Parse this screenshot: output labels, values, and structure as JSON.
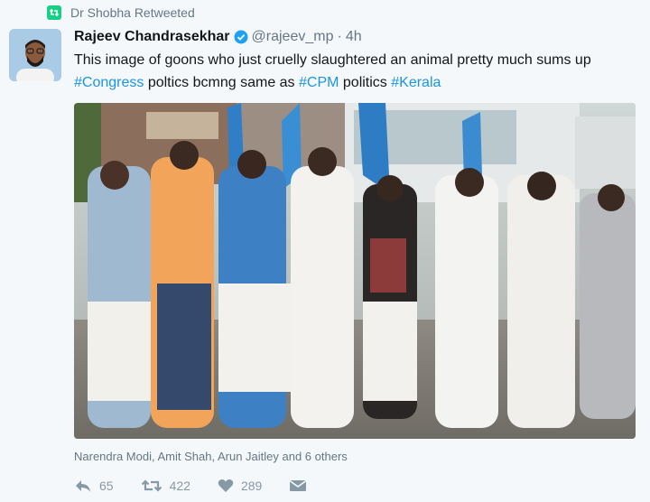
{
  "retweet": {
    "label": "Dr Shobha Retweeted"
  },
  "tweet": {
    "author": "Rajeev Chandrasekhar",
    "handle": "@rajeev_mp",
    "separator": "·",
    "time": "4h",
    "text_1": "This image of goons who just cruelly slaughtered an animal pretty much sums up ",
    "hashtag_1": "#Congress",
    "text_2": " poltics bcmng same as ",
    "hashtag_2": "#CPM",
    "text_3": " politics ",
    "hashtag_3": "#Kerala"
  },
  "likers": {
    "text": "Narendra Modi, Amit Shah, Arun Jaitley and 6 others"
  },
  "actions": {
    "replies": "65",
    "retweets": "422",
    "likes": "289"
  },
  "icons": {
    "retweet_badge": "retweet-icon",
    "verified": "verified-badge-icon",
    "reply": "reply-icon",
    "retweet": "retweet-icon",
    "like": "heart-icon",
    "message": "envelope-icon"
  },
  "colors": {
    "link": "#1b95e0",
    "retweet_green": "#19cf86",
    "muted": "#657786"
  }
}
